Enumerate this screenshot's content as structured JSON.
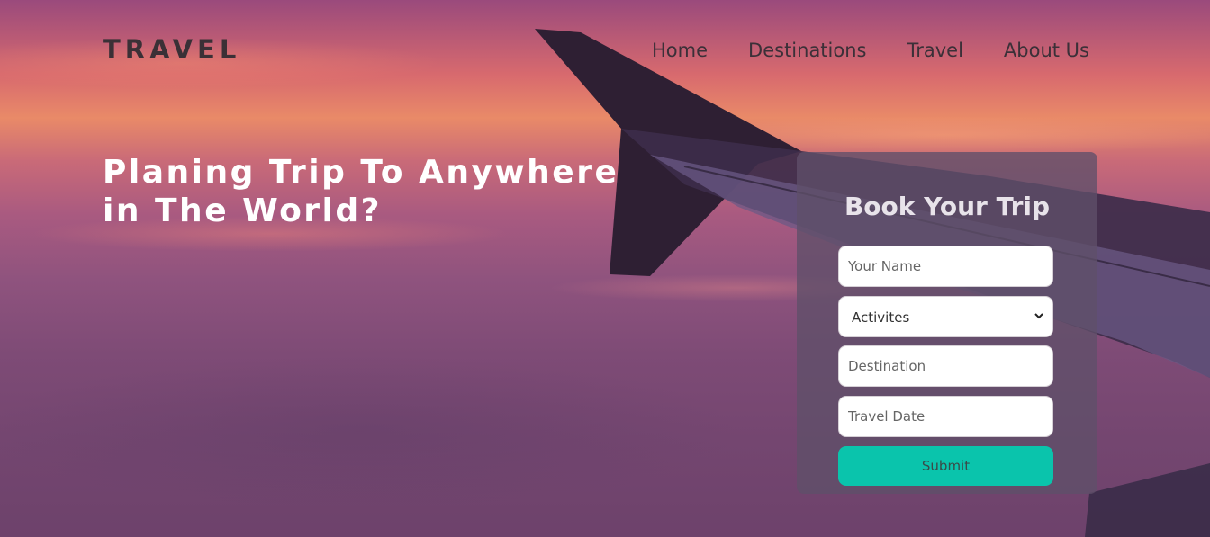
{
  "header": {
    "logo": "TRAVEL",
    "nav": [
      "Home",
      "Destinations",
      "Travel",
      "About Us"
    ]
  },
  "hero": {
    "headline_line1": "Planing Trip To Anywhere",
    "headline_line2": "in The World?"
  },
  "booking": {
    "title": "Book Your Trip",
    "name_placeholder": "Your Name",
    "activities_selected": "Activites",
    "destination_placeholder": "Destination",
    "date_placeholder": "Travel Date",
    "submit_label": "Submit"
  },
  "colors": {
    "accent": "#0ac4ac",
    "panel": "#5f5069",
    "text_dark": "#3a3036"
  }
}
